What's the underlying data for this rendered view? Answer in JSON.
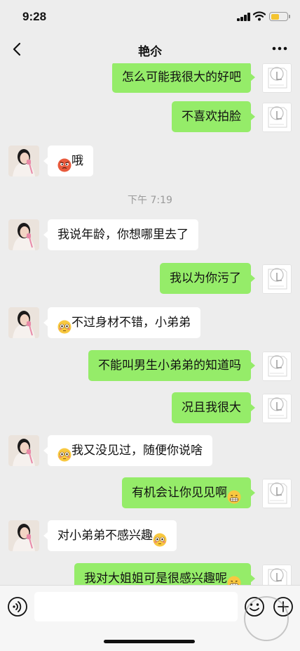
{
  "status_bar": {
    "time": "9:28"
  },
  "nav": {
    "title": "艳尒"
  },
  "timestamp": "下午 7:19",
  "messages": [
    {
      "side": "right",
      "text": "怎么可能我很大的好吧",
      "emoji": ""
    },
    {
      "side": "right",
      "text": "不喜欢拍脸",
      "emoji": ""
    },
    {
      "side": "left",
      "text": "哦",
      "emoji": "angry-face"
    },
    {
      "side": "left",
      "text": "我说年龄，你想哪里去了",
      "emoji": ""
    },
    {
      "side": "right",
      "text": "我以为你污了",
      "emoji": ""
    },
    {
      "side": "left",
      "text": "不过身材不错，小弟弟",
      "emoji": "flushed-face"
    },
    {
      "side": "right",
      "text": "不能叫男生小弟弟的知道吗",
      "emoji": ""
    },
    {
      "side": "right",
      "text": "况且我很大",
      "emoji": ""
    },
    {
      "side": "left",
      "text": "我又没见过，随便你说啥",
      "emoji": "flushed-face"
    },
    {
      "side": "right",
      "text": "有机会让你见见啊",
      "emoji": "grimacing-face"
    },
    {
      "side": "left",
      "text": "对小弟弟不感兴趣",
      "emoji": "flushed-face"
    },
    {
      "side": "right",
      "text": "我对大姐姐可是很感兴趣呢",
      "emoji": "grimacing-face"
    }
  ],
  "colors": {
    "sent_bubble": "#95ec69",
    "received_bubble": "#ffffff",
    "background": "#ededed",
    "battery": "#f4c430"
  }
}
